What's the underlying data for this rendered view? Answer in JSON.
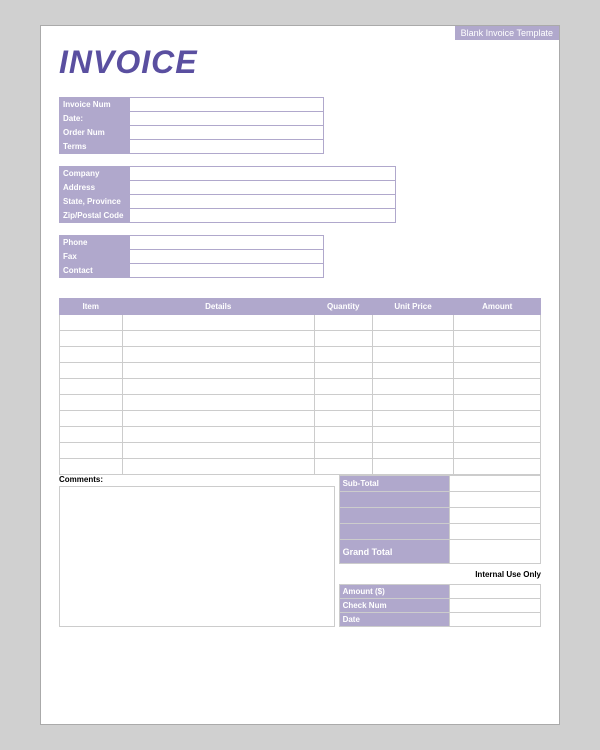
{
  "template": {
    "label": "Blank Invoice Template"
  },
  "header": {
    "title": "INVOICE"
  },
  "info_fields": {
    "invoice_num_label": "Invoice Num",
    "date_label": "Date:",
    "order_num_label": "Order Num",
    "terms_label": "Terms"
  },
  "company_fields": {
    "company_label": "Company",
    "address_label": "Address",
    "state_province_label": "State, Province",
    "zip_postal_label": "Zip/Postal Code"
  },
  "contact_fields": {
    "phone_label": "Phone",
    "fax_label": "Fax",
    "contact_label": "Contact"
  },
  "items_table": {
    "col_item": "Item",
    "col_details": "Details",
    "col_quantity": "Quantity",
    "col_unit_price": "Unit Price",
    "col_amount": "Amount",
    "rows": [
      {
        "item": "",
        "details": "",
        "quantity": "",
        "unit_price": "",
        "amount": ""
      },
      {
        "item": "",
        "details": "",
        "quantity": "",
        "unit_price": "",
        "amount": ""
      },
      {
        "item": "",
        "details": "",
        "quantity": "",
        "unit_price": "",
        "amount": ""
      },
      {
        "item": "",
        "details": "",
        "quantity": "",
        "unit_price": "",
        "amount": ""
      },
      {
        "item": "",
        "details": "",
        "quantity": "",
        "unit_price": "",
        "amount": ""
      },
      {
        "item": "",
        "details": "",
        "quantity": "",
        "unit_price": "",
        "amount": ""
      },
      {
        "item": "",
        "details": "",
        "quantity": "",
        "unit_price": "",
        "amount": ""
      },
      {
        "item": "",
        "details": "",
        "quantity": "",
        "unit_price": "",
        "amount": ""
      },
      {
        "item": "",
        "details": "",
        "quantity": "",
        "unit_price": "",
        "amount": ""
      },
      {
        "item": "",
        "details": "",
        "quantity": "",
        "unit_price": "",
        "amount": ""
      }
    ]
  },
  "bottom": {
    "comments_label": "Comments:",
    "subtotal_label": "Sub-Total",
    "blank_row1": "",
    "blank_row2": "",
    "blank_row3": "",
    "grand_total_label": "Grand Total",
    "internal_use_label": "Internal Use Only",
    "amount_label": "Amount ($)",
    "check_num_label": "Check Num",
    "date_label": "Date"
  }
}
